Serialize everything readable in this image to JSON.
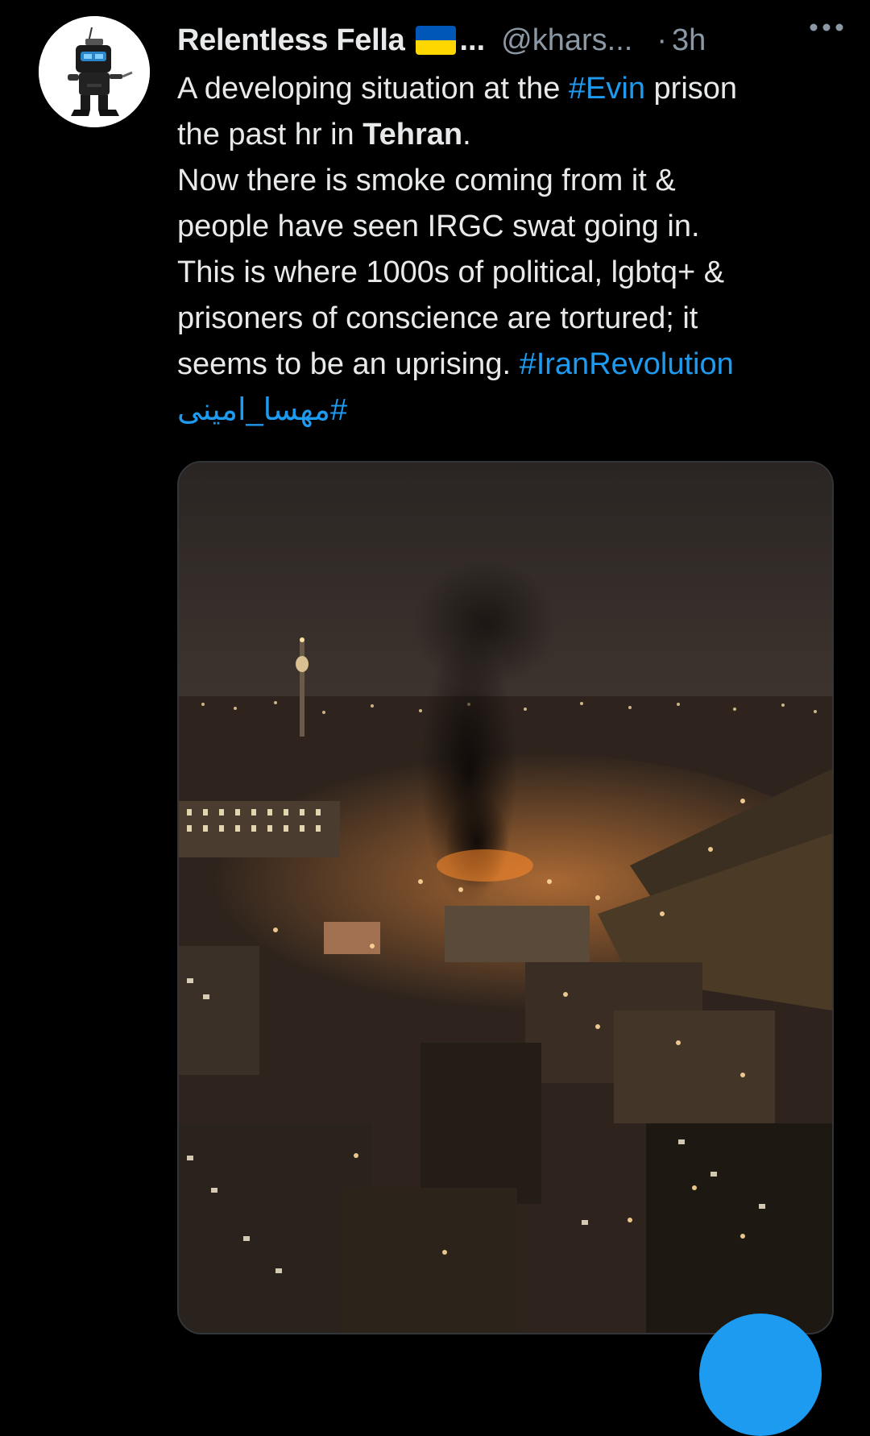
{
  "tweet": {
    "author": {
      "display_name": "Relentless Fella",
      "name_overflow": "...",
      "handle": "@khars...",
      "flag_icon": "ukraine-flag",
      "flag_colors": [
        "#0057b7",
        "#ffd700"
      ]
    },
    "separator": "·",
    "time": "3h",
    "more_icon": "more-horizontal-icon",
    "text": {
      "l1_a": "A developing situation at the ",
      "l1_tag": "#Evin",
      "l1_b": " prison",
      "l2_a": "the past hr in ",
      "l2_bold": "Tehran",
      "l2_b": ".",
      "l3": "Now there is smoke coming from it &",
      "l4": "people have seen IRGC swat going in.",
      "l5": "This is where 1000s of political, lgbtq+ &",
      "l6": "prisoners of conscience are tortured; it",
      "l7_a": "seems to be an uprising. ",
      "l7_tag": "#IranRevolution",
      "l8_tag": "#مهسا_امینی"
    },
    "media": {
      "alt": "Night view of Tehran with black smoke rising from Evin prison"
    }
  },
  "compose_button": {
    "icon": "compose-icon"
  },
  "colors": {
    "background": "#000000",
    "text": "#e7e9ea",
    "secondary_text": "#8b98a5",
    "link": "#1d9bf0",
    "media_border": "#333639"
  }
}
